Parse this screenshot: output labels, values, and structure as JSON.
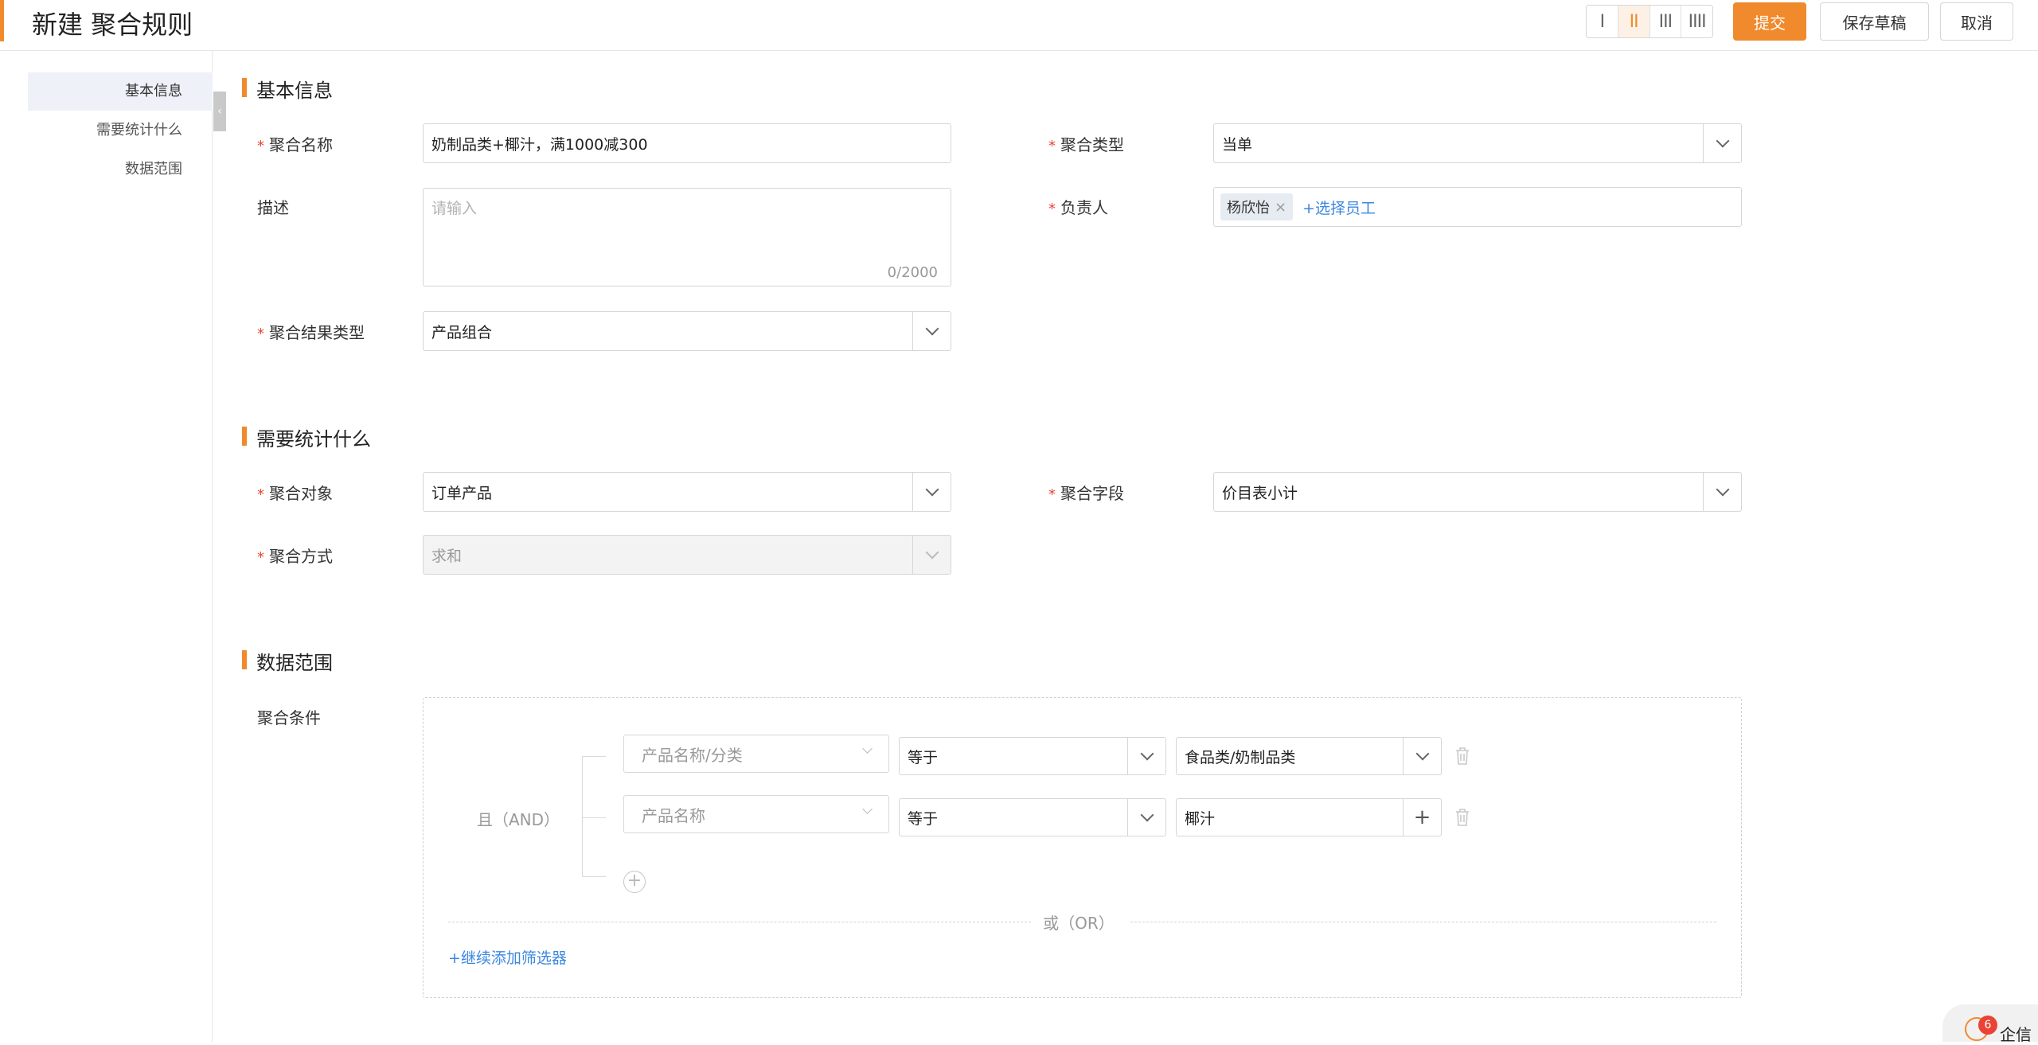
{
  "header": {
    "title": "新建 聚合规则",
    "layout_options": [
      "I",
      "II",
      "III",
      "IIII"
    ],
    "active_layout": 1,
    "submit_label": "提交",
    "save_draft_label": "保存草稿",
    "cancel_label": "取消"
  },
  "sidenav": {
    "items": [
      {
        "label": "基本信息",
        "active": true
      },
      {
        "label": "需要统计什么",
        "active": false
      },
      {
        "label": "数据范围",
        "active": false
      }
    ],
    "collapse_icon": "‹"
  },
  "sections": {
    "basic": {
      "title": "基本信息",
      "name_label": "聚合名称",
      "name_value": "奶制品类+椰汁，满1000减300",
      "type_label": "聚合类型",
      "type_value": "当单",
      "desc_label": "描述",
      "desc_placeholder": "请输入",
      "desc_count": "0/2000",
      "owner_label": "负责人",
      "owner_tag": "杨欣怡",
      "owner_tag_remove": "×",
      "owner_add": "+选择员工",
      "result_type_label": "聚合结果类型",
      "result_type_value": "产品组合"
    },
    "stats": {
      "title": "需要统计什么",
      "object_label": "聚合对象",
      "object_value": "订单产品",
      "field_label": "聚合字段",
      "field_value": "价目表小计",
      "method_label": "聚合方式",
      "method_value": "求和"
    },
    "scope": {
      "title": "数据范围",
      "condition_label": "聚合条件",
      "and_label": "且（AND）",
      "rows": [
        {
          "field": "产品名称/分类",
          "operator": "等于",
          "value": "食品类/奶制品类"
        },
        {
          "field": "产品名称",
          "operator": "等于",
          "value": "椰汁"
        }
      ],
      "or_label": "或（OR）",
      "add_filter": "+继续添加筛选器",
      "add_condition_icon": "+"
    }
  },
  "widget": {
    "badge_count": "6",
    "label": "企信"
  },
  "colors": {
    "accent": "#f08a2c",
    "required": "#e94335",
    "link": "#3c87e0"
  }
}
